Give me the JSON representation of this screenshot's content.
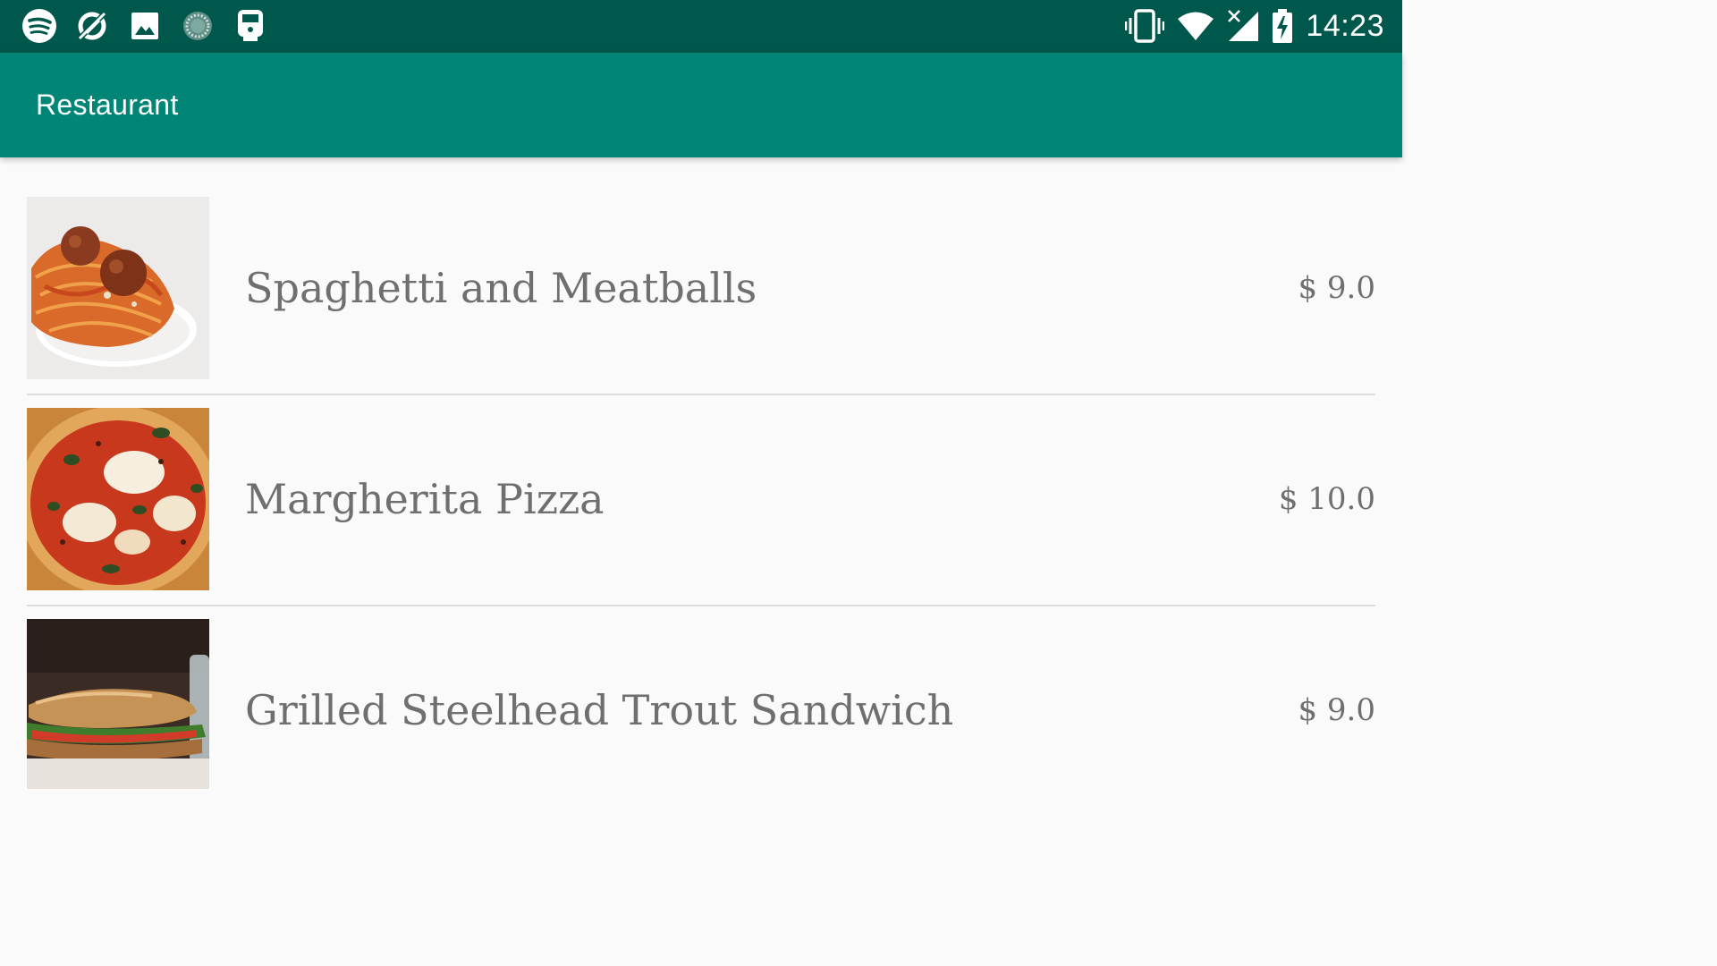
{
  "status_bar": {
    "time": "14:23",
    "left_icons": [
      "spotify-icon",
      "no-data-saver-icon",
      "image-icon",
      "sync-progress-icon",
      "train-icon"
    ],
    "right_icons": [
      "vibrate-icon",
      "wifi-icon",
      "signal-icon",
      "battery-charging-icon"
    ],
    "background": "#00574b"
  },
  "app_bar": {
    "title": "Restaurant",
    "background": "#008577"
  },
  "menu": {
    "items": [
      {
        "name": "Spaghetti and Meatballs",
        "price": "$ 9.0",
        "image": "spaghetti-image"
      },
      {
        "name": "Margherita Pizza",
        "price": "$ 10.0",
        "image": "pizza-image"
      },
      {
        "name": "Grilled Steelhead Trout Sandwich",
        "price": "$ 9.0",
        "image": "sandwich-image"
      }
    ]
  },
  "colors": {
    "text": "#6f6f6f",
    "divider": "#dcdcdc",
    "page_background": "#fafafa"
  }
}
